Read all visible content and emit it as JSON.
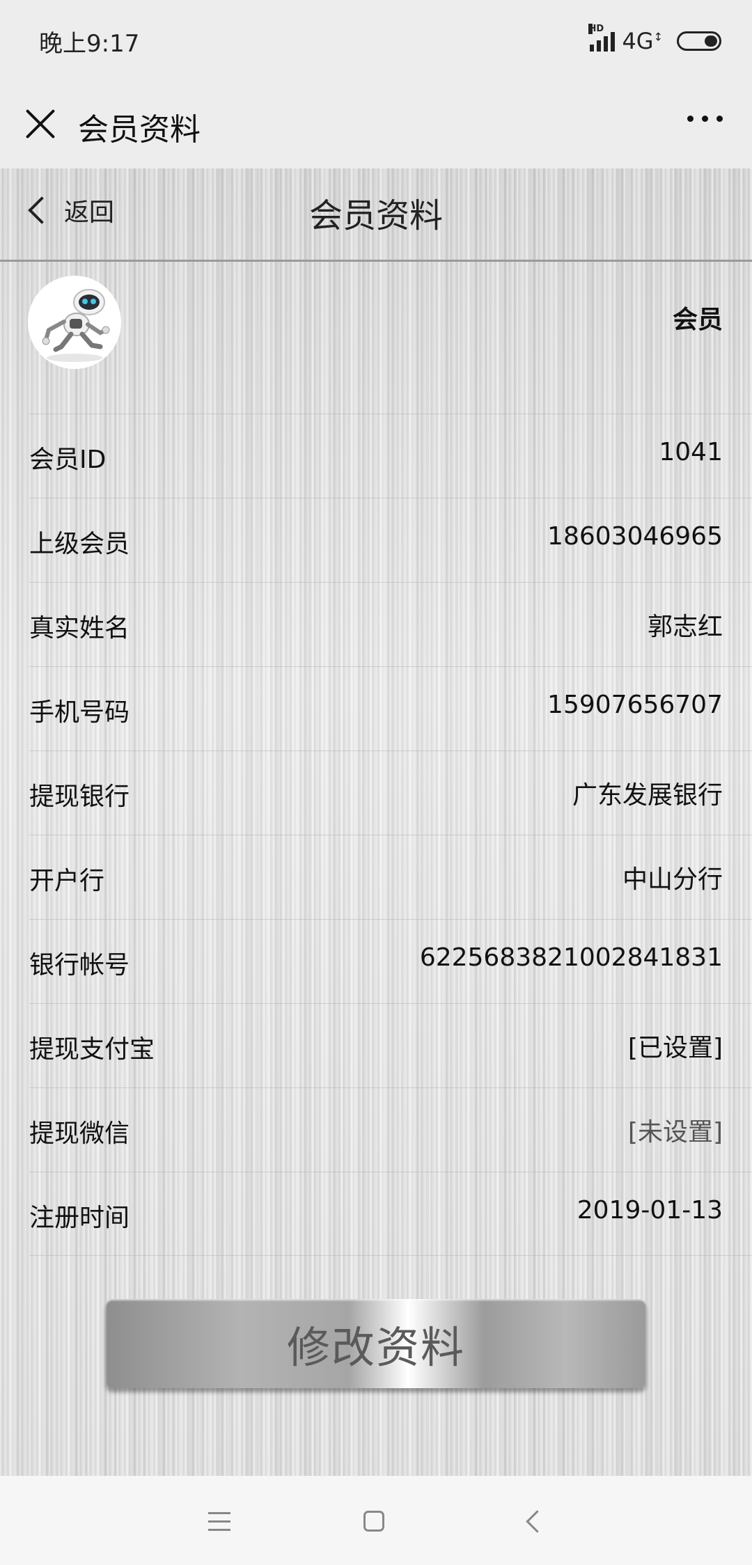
{
  "status_bar": {
    "time": "晚上9:17",
    "hd_label": "HD",
    "network": "4G"
  },
  "wechat_bar": {
    "title": "会员资料"
  },
  "header": {
    "back_label": "返回",
    "title": "会员资料"
  },
  "profile": {
    "member_type": "会员"
  },
  "info": [
    {
      "label": "会员ID",
      "value": "1041"
    },
    {
      "label": "上级会员",
      "value": "18603046965"
    },
    {
      "label": "真实姓名",
      "value": "郭志红"
    },
    {
      "label": "手机号码",
      "value": "15907656707"
    },
    {
      "label": "提现银行",
      "value": "广东发展银行"
    },
    {
      "label": "开户行",
      "value": "中山分行"
    },
    {
      "label": "银行帐号",
      "value": "6225683821002841831"
    },
    {
      "label": "提现支付宝",
      "value": "[已设置]"
    },
    {
      "label": "提现微信",
      "value": "[未设置]"
    },
    {
      "label": "注册时间",
      "value": "2019-01-13"
    }
  ],
  "actions": {
    "edit_label": "修改资料"
  }
}
